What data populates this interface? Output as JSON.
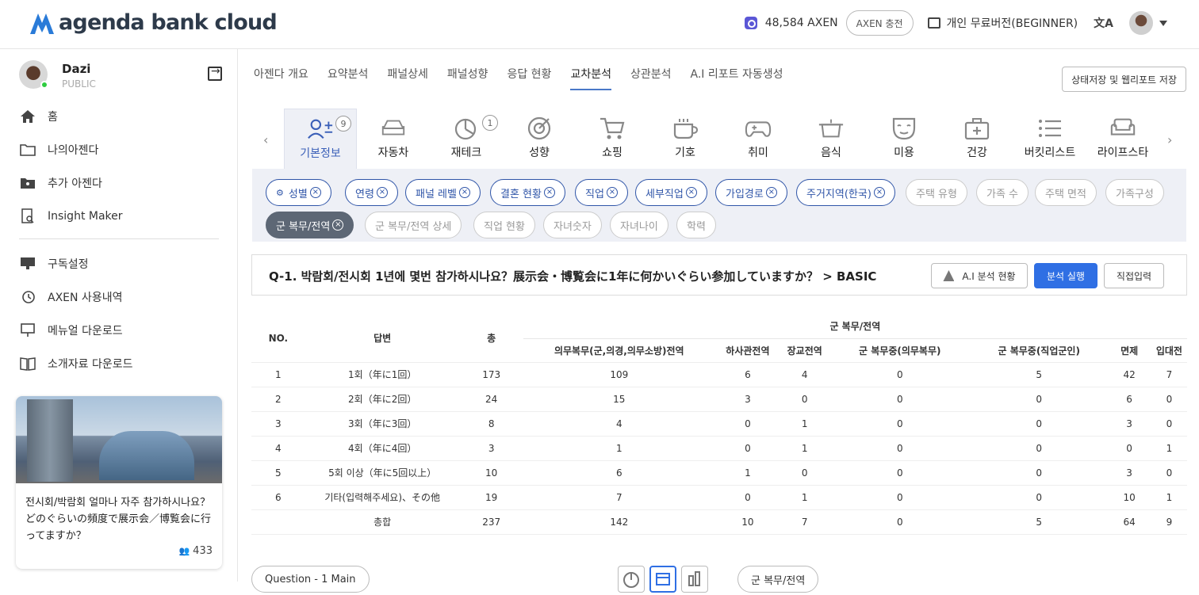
{
  "header": {
    "logo_text": "agenda bank cloud",
    "axen_balance": "48,584 AXEN",
    "charge_label": "AXEN 충전",
    "plan_label": "개인 무료버전(BEGINNER)"
  },
  "sidebar": {
    "user_name": "Dazi",
    "user_type": "PUBLIC",
    "menu_top": [
      {
        "label": "홈",
        "icon": "home-icon"
      },
      {
        "label": "나의아젠다",
        "icon": "folder-icon"
      },
      {
        "label": "추가 아젠다",
        "icon": "folder-user-icon"
      },
      {
        "label": "Insight Maker",
        "icon": "search-doc-icon"
      }
    ],
    "menu_bottom": [
      {
        "label": "구독설정",
        "icon": "monitor-icon"
      },
      {
        "label": "AXEN 사용내역",
        "icon": "history-icon"
      },
      {
        "label": "메뉴얼 다운로드",
        "icon": "presentation-icon"
      },
      {
        "label": "소개자료 다운로드",
        "icon": "book-icon"
      }
    ],
    "card": {
      "text": "전시회/박람회 얼마나 자주 참가하시나요？どのぐらいの頻度で展示会／博覧会に行ってますか？",
      "count": "433"
    }
  },
  "main": {
    "tabs": [
      "아젠다 개요",
      "요약분석",
      "패널상세",
      "패널성향",
      "응답 현황",
      "교차분석",
      "상관분석",
      "A.I 리포트 자동생성"
    ],
    "active_tab": "교차분석",
    "save_label": "상태저장 및 웹리포트 저장",
    "categories": [
      {
        "label": "기본정보",
        "badge": "9",
        "icon": "user-plus-icon"
      },
      {
        "label": "자동차",
        "badge": "",
        "icon": "car-icon"
      },
      {
        "label": "재테크",
        "badge": "1",
        "icon": "pie-chart-icon"
      },
      {
        "label": "성향",
        "badge": "",
        "icon": "target-icon"
      },
      {
        "label": "쇼핑",
        "badge": "",
        "icon": "cart-icon"
      },
      {
        "label": "기호",
        "badge": "",
        "icon": "coffee-icon"
      },
      {
        "label": "취미",
        "badge": "",
        "icon": "gamepad-icon"
      },
      {
        "label": "음식",
        "badge": "",
        "icon": "pot-icon"
      },
      {
        "label": "미용",
        "badge": "",
        "icon": "mask-icon"
      },
      {
        "label": "건강",
        "badge": "",
        "icon": "medkit-icon"
      },
      {
        "label": "버킷리스트",
        "badge": "",
        "icon": "list-icon"
      },
      {
        "label": "라이프스타",
        "badge": "",
        "icon": "sofa-icon"
      }
    ],
    "chips": [
      {
        "label": "성별",
        "state": "on",
        "has_icon": true
      },
      {
        "label": "연령",
        "state": "on"
      },
      {
        "label": "패널 레벨",
        "state": "on"
      },
      {
        "label": "결혼 현황",
        "state": "on"
      },
      {
        "label": "직업",
        "state": "on"
      },
      {
        "label": "세부직업",
        "state": "on"
      },
      {
        "label": "가입경로",
        "state": "on"
      },
      {
        "label": "주거지역(한국)",
        "state": "on"
      },
      {
        "label": "주택 유형",
        "state": "off"
      },
      {
        "label": "가족 수",
        "state": "off"
      },
      {
        "label": "주택 면적",
        "state": "off"
      },
      {
        "label": "가족구성",
        "state": "off"
      },
      {
        "label": "군 복무/전역",
        "state": "sel"
      },
      {
        "label": "군 복무/전역 상세",
        "state": "off"
      },
      {
        "label": "직업 현황",
        "state": "off"
      },
      {
        "label": "자녀숫자",
        "state": "off"
      },
      {
        "label": "자녀나이",
        "state": "off"
      },
      {
        "label": "학력",
        "state": "off"
      }
    ],
    "question": "Q-1. 박람회/전시회 1년에 몇번 참가하시나요？展示会・博覧会に1年に何かいぐらい参加していますか？ > BASIC",
    "ai_status_label": "A.I 분석 현황",
    "run_label": "분석 실행",
    "direct_label": "직접입력"
  },
  "table": {
    "group_label": "군 복무/전역",
    "col_no": "NO.",
    "col_answer": "답변",
    "col_total": "총",
    "sub_cols": [
      "의무복무(군,의경,의무소방)전역",
      "하사관전역",
      "장교전역",
      "군 복무중(의무복무)",
      "군 복무중(직업군인)",
      "면제",
      "입대전"
    ],
    "rows": [
      {
        "no": "1",
        "answer": "1회（年に1回）",
        "total": "173",
        "vals": [
          "109",
          "6",
          "4",
          "0",
          "5",
          "42",
          "7"
        ]
      },
      {
        "no": "2",
        "answer": "2회（年に2回）",
        "total": "24",
        "vals": [
          "15",
          "3",
          "0",
          "0",
          "0",
          "6",
          "0"
        ]
      },
      {
        "no": "3",
        "answer": "3회（年に3回）",
        "total": "8",
        "vals": [
          "4",
          "0",
          "1",
          "0",
          "0",
          "3",
          "0"
        ]
      },
      {
        "no": "4",
        "answer": "4회（年に4回）",
        "total": "3",
        "vals": [
          "1",
          "0",
          "1",
          "0",
          "0",
          "0",
          "1"
        ]
      },
      {
        "no": "5",
        "answer": "5회 이상（年に5回以上）",
        "total": "10",
        "vals": [
          "6",
          "1",
          "0",
          "0",
          "0",
          "3",
          "0"
        ]
      },
      {
        "no": "6",
        "answer": "기타(입력해주세요)、その他",
        "total": "19",
        "vals": [
          "7",
          "0",
          "1",
          "0",
          "0",
          "10",
          "1"
        ]
      }
    ],
    "sum": {
      "no": "",
      "answer": "총합",
      "total": "237",
      "vals": [
        "142",
        "10",
        "7",
        "0",
        "5",
        "64",
        "9"
      ]
    }
  },
  "bottom": {
    "question_select": "Question - 1 Main",
    "group_select": "군 복무/전역"
  }
}
